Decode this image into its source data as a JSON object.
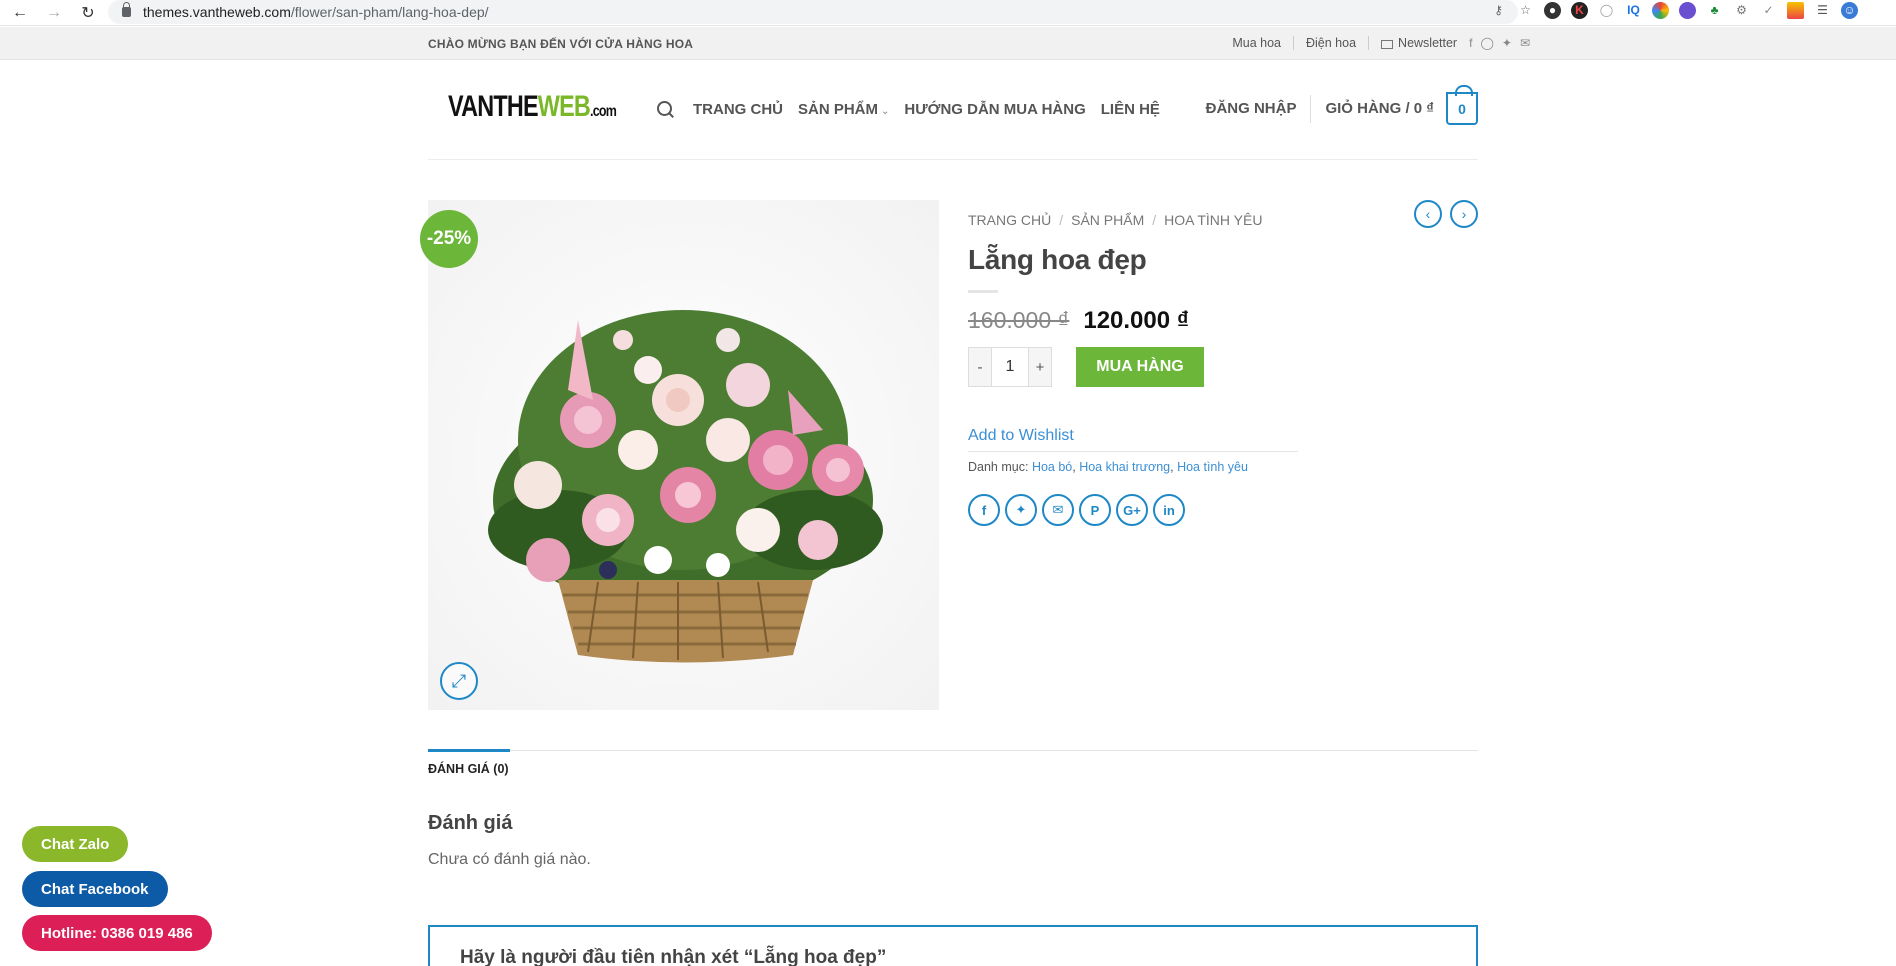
{
  "browser": {
    "url_host": "themes.vantheweb.com",
    "url_path": "/flower/san-pham/lang-hoa-dep/"
  },
  "topbar": {
    "welcome": "CHÀO MỪNG BẠN ĐẾN VỚI CỬA HÀNG HOA",
    "links": [
      "Mua hoa",
      "Điện hoa",
      "Newsletter"
    ]
  },
  "header": {
    "logo_part1": "VANTHE",
    "logo_part2": "WEB",
    "logo_part3": ".com",
    "nav": [
      "TRANG CHỦ",
      "SẢN PHẨM",
      "HƯỚNG DẪN MUA HÀNG",
      "LIÊN HỆ"
    ],
    "login": "ĐĂNG NHẬP",
    "cart_label": "GIỎ HÀNG / 0 ₫",
    "cart_count": "0"
  },
  "product": {
    "badge": "-25%",
    "breadcrumb": [
      "TRANG CHỦ",
      "SẢN PHẨM",
      "HOA TÌNH YÊU"
    ],
    "title": "Lẵng hoa đẹp",
    "old_price": "160.000 ₫",
    "new_price": "120.000 ₫",
    "qty_minus": "-",
    "qty": "1",
    "qty_plus": "+",
    "buy_label": "MUA HÀNG",
    "wishlist": "Add to Wishlist",
    "category_label": "Danh mục:",
    "categories": [
      "Hoa bó",
      "Hoa khai trương",
      "Hoa tình yêu"
    ]
  },
  "reviews": {
    "tab": "ĐÁNH GIÁ (0)",
    "title": "Đánh giá",
    "empty": "Chưa có đánh giá nào.",
    "form_title": "Hãy là người đầu tiên nhận xét “Lẵng hoa đẹp”"
  },
  "floating": {
    "zalo": "Chat Zalo",
    "facebook": "Chat Facebook",
    "hotline": "Hotline: 0386 019 486"
  },
  "colors": {
    "accent": "#1e88c7",
    "green": "#6cb63a",
    "hotline": "#dd1f57",
    "facebook": "#0d5aa6"
  }
}
